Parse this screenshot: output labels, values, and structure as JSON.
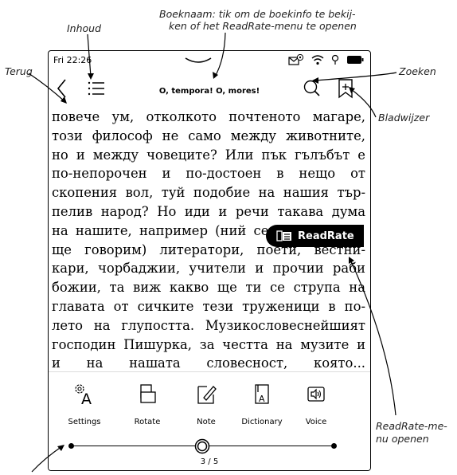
{
  "callouts": {
    "inhoud": "Inhoud",
    "boeknaam_1": "Boeknaam: tik om de boekinfo te bekij-",
    "boeknaam_2": "ken of het ReadRate-menu te openen",
    "terug": "Terug",
    "zoeken": "Zoeken",
    "bladwijzer": "Bladwijzer",
    "readrate_menu_1": "ReadRate-me-",
    "readrate_menu_2": "nu openen"
  },
  "status": {
    "time": "Fri 22:26"
  },
  "toolbar": {
    "book_title": "O, tempora! O, mores!"
  },
  "book_text": [
    "повече ум, отколкото почтеното магаре,",
    "този философ не само между животните,",
    "но и между човеците? Или пък гълъбът е",
    "по-непорочен и по-достоен в нещо от",
    "скопения вол, туй подобие на нашия тър-",
    "пелив народ? Но иди и речи такава дума",
    "на нашите, например (ний се",
    "ще говорим) литератори, поети, вестни-",
    "кари, чорбаджии, учители и прочии раби",
    "божии, та виж какво ще ти се струпа на",
    "главата от сичките тези труженици в по-",
    "лето на глупостта. Музикословеснейшият",
    "господин Пишурка, за честта на музите и",
    "и на нашата словесност, която..."
  ],
  "readrate_button": {
    "label": "ReadRate"
  },
  "panel": {
    "buttons": [
      {
        "label": "Settings",
        "icon": "settings-font-icon"
      },
      {
        "label": "Rotate",
        "icon": "rotate-icon"
      },
      {
        "label": "Note",
        "icon": "note-icon"
      },
      {
        "label": "Dictionary",
        "icon": "dictionary-icon"
      },
      {
        "label": "Voice",
        "icon": "voice-icon"
      }
    ],
    "page": "3 / 5",
    "progress": 0.5
  }
}
